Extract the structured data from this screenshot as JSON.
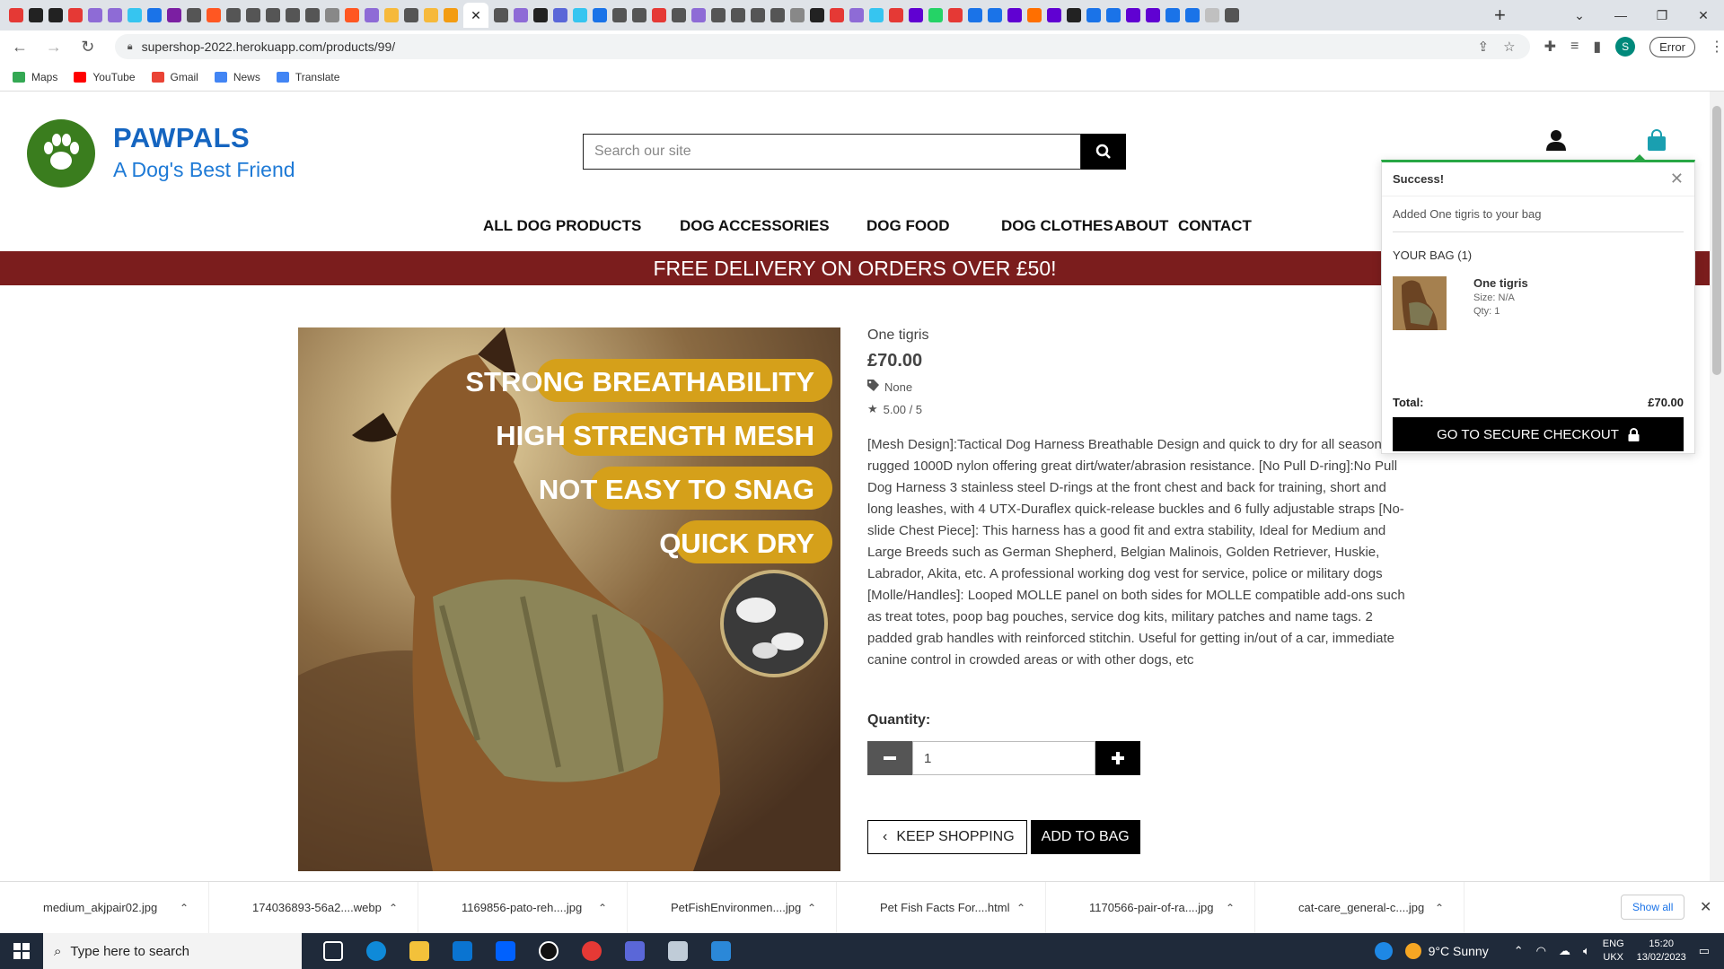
{
  "browser": {
    "url": "supershop-2022.herokuapp.com/products/99/",
    "profile_initial": "S",
    "error_label": "Error",
    "bookmarks": [
      "Maps",
      "YouTube",
      "Gmail",
      "News",
      "Translate"
    ]
  },
  "site": {
    "brand_name": "PAWPALS",
    "tagline": "A Dog's Best Friend",
    "search_placeholder": "Search our site",
    "nav": [
      "ALL DOG PRODUCTS",
      "DOG ACCESSORIES",
      "DOG FOOD",
      "DOG CLOTHES",
      "ABOUT",
      "CONTACT"
    ],
    "banner": "FREE DELIVERY ON ORDERS OVER £50!"
  },
  "product": {
    "name": "One tigris",
    "price": "£70.00",
    "category": "None",
    "rating": "5.00 / 5",
    "image_lines": [
      "STRONG BREATHABILITY",
      "HIGH STRENGTH MESH",
      "NOT EASY TO SNAG",
      "QUICK DRY"
    ],
    "description": "[Mesh Design]:Tactical Dog Harness Breathable Design and quick to dry for all seasons, rugged 1000D nylon offering great dirt/water/abrasion resistance. [No Pull D-ring]:No Pull Dog Harness 3 stainless steel D-rings at the front chest and back for training, short and long leashes, with 4 UTX-Duraflex quick-release buckles and 6 fully adjustable straps [No-slide Chest Piece]: This harness has a good fit and extra stability, Ideal for Medium and Large Breeds such as German Shepherd, Belgian Malinois, Golden Retriever, Huskie, Labrador, Akita, etc. A professional working dog vest for service, police or military dogs [Molle/Handles]: Looped MOLLE panel on both sides for MOLLE compatible add-ons such as treat totes, poop bag pouches, service dog kits, military patches and name tags. 2 padded grab handles with reinforced stitchin. Useful for getting in/out of a car, immediate canine control in crowded areas or with other dogs, etc",
    "quantity_label": "Quantity:",
    "quantity_value": "1",
    "keep_shopping": "KEEP SHOPPING",
    "add_to_bag": "ADD TO BAG"
  },
  "toast": {
    "title": "Success!",
    "message": "Added One tigris to your bag",
    "bag_heading": "YOUR BAG (1)",
    "item_name": "One tigris",
    "item_size": "Size: N/A",
    "item_qty": "Qty: 1",
    "total_label": "Total:",
    "total_value": "£70.00",
    "checkout": "GO TO SECURE CHECKOUT"
  },
  "downloads": {
    "files": [
      "medium_akjpair02.jpg",
      "174036893-56a2....webp",
      "1169856-pato-reh....jpg",
      "PetFishEnvironmen....jpg",
      "Pet Fish Facts For....html",
      "1170566-pair-of-ra....jpg",
      "cat-care_general-c....jpg"
    ],
    "show_all": "Show all"
  },
  "taskbar": {
    "search_placeholder": "Type here to search",
    "weather": "9°C  Sunny",
    "lang1": "ENG",
    "lang2": "UKX",
    "time": "15:20",
    "date": "13/02/2023"
  }
}
